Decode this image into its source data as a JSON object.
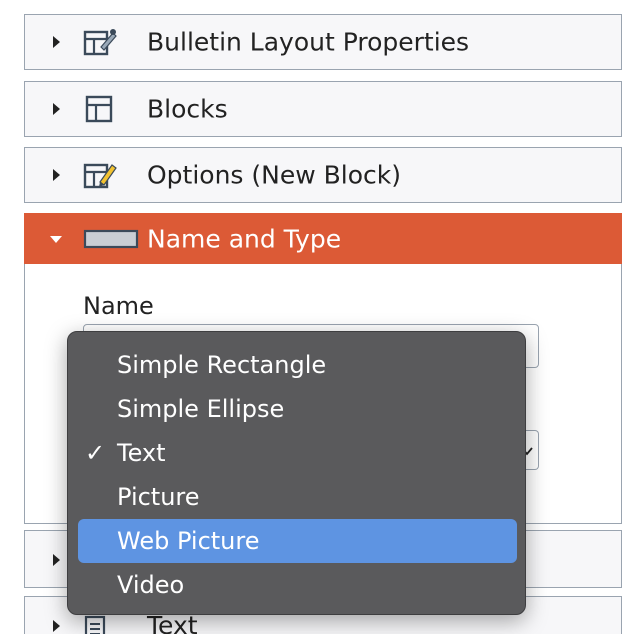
{
  "panels": [
    {
      "title": "Bulletin Layout Properties",
      "icon": "layout-properties-icon"
    },
    {
      "title": "Blocks",
      "icon": "blocks-layout-icon"
    },
    {
      "title": "Options (New Block)",
      "icon": "block-options-edit-icon"
    },
    {
      "title": "Name and Type",
      "icon": "rectangle-icon",
      "expanded": true
    },
    {
      "title": "Text",
      "icon": "document-icon"
    }
  ],
  "name_field": {
    "label": "Name",
    "value": ""
  },
  "type_menu": {
    "selected": "Text",
    "highlighted": "Web Picture",
    "options": [
      {
        "label": "Simple Rectangle",
        "check": ""
      },
      {
        "label": "Simple Ellipse",
        "check": ""
      },
      {
        "label": "Text",
        "check": "✓"
      },
      {
        "label": "Picture",
        "check": ""
      },
      {
        "label": "Web Picture",
        "check": ""
      },
      {
        "label": "Video",
        "check": ""
      }
    ]
  },
  "colors": {
    "active_header": "#dc5a36",
    "menu_background": "#5a5a5c",
    "menu_highlight": "#5e94e2",
    "panel_border": "#9aa4b0"
  }
}
